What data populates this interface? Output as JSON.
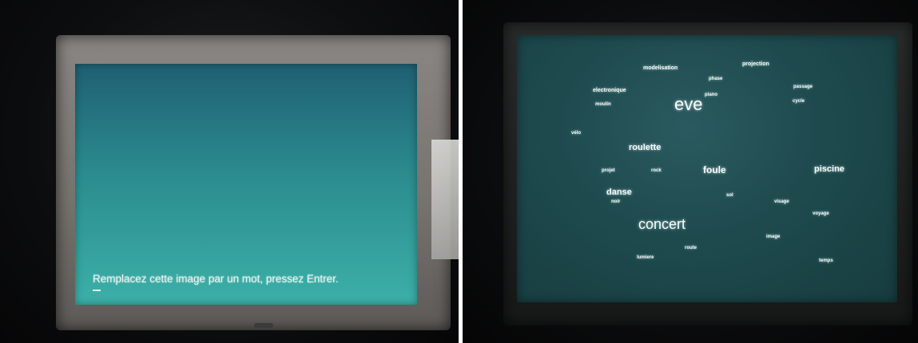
{
  "left_photo": {
    "screen_prompt": "Remplacez cette image par un mot, pressez Entrer."
  },
  "right_photo": {
    "words": [
      "modelisation",
      "projection",
      "phase",
      "electronique",
      "piano",
      "eve",
      "passage",
      "moulin",
      "cycle",
      "vélo",
      "roulette",
      "projet",
      "rock",
      "foule",
      "piscine",
      "concert",
      "danse",
      "visage",
      "voyage",
      "sol",
      "noir",
      "route",
      "image",
      "lumiere",
      "temps"
    ]
  }
}
